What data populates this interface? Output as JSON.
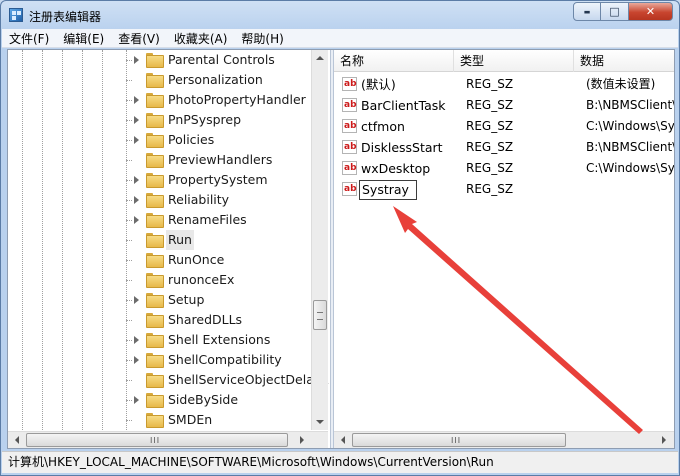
{
  "window": {
    "title": "注册表编辑器",
    "minimize_glyph": "▬",
    "maximize_glyph": "□",
    "close_glyph": "✕"
  },
  "menu": [
    "文件(F)",
    "编辑(E)",
    "查看(V)",
    "收藏夹(A)",
    "帮助(H)"
  ],
  "tree": {
    "items": [
      {
        "label": "Parental Controls",
        "expandable": true
      },
      {
        "label": "Personalization",
        "expandable": false
      },
      {
        "label": "PhotoPropertyHandler",
        "expandable": true
      },
      {
        "label": "PnPSysprep",
        "expandable": true
      },
      {
        "label": "Policies",
        "expandable": true
      },
      {
        "label": "PreviewHandlers",
        "expandable": false
      },
      {
        "label": "PropertySystem",
        "expandable": true
      },
      {
        "label": "Reliability",
        "expandable": true
      },
      {
        "label": "RenameFiles",
        "expandable": true
      },
      {
        "label": "Run",
        "expandable": false,
        "selected": true
      },
      {
        "label": "RunOnce",
        "expandable": false
      },
      {
        "label": "runonceEx",
        "expandable": false
      },
      {
        "label": "Setup",
        "expandable": true
      },
      {
        "label": "SharedDLLs",
        "expandable": false
      },
      {
        "label": "Shell Extensions",
        "expandable": true
      },
      {
        "label": "ShellCompatibility",
        "expandable": true
      },
      {
        "label": "ShellServiceObjectDelayL",
        "expandable": false
      },
      {
        "label": "SideBySide",
        "expandable": true
      },
      {
        "label": "SMDEn",
        "expandable": false
      }
    ],
    "hscroll_grip": "III"
  },
  "list": {
    "headers": {
      "name": "名称",
      "type": "类型",
      "data": "数据"
    },
    "value_icon": "ab",
    "rows": [
      {
        "name": "(默认)",
        "type": "REG_SZ",
        "data": "(数值未设置)"
      },
      {
        "name": "BarClientTask",
        "type": "REG_SZ",
        "data": "B:\\NBMSClient\\"
      },
      {
        "name": "ctfmon",
        "type": "REG_SZ",
        "data": "C:\\Windows\\Sys"
      },
      {
        "name": "DisklessStart",
        "type": "REG_SZ",
        "data": "B:\\NBMSClient\\"
      },
      {
        "name": "wxDesktop",
        "type": "REG_SZ",
        "data": "C:\\Windows\\Sys"
      },
      {
        "name": "Systray",
        "type": "REG_SZ",
        "data": "",
        "editing": true
      }
    ],
    "hscroll_grip": "III"
  },
  "status": {
    "path": "计算机\\HKEY_LOCAL_MACHINE\\SOFTWARE\\Microsoft\\Windows\\CurrentVersion\\Run"
  },
  "colors": {
    "arrow": "#e8403a",
    "title_bar": "#b9d1ee",
    "close_button": "#c8452f",
    "selection": "#e8e8e8"
  },
  "icons": {
    "app": "registry-editor-icon",
    "folder": "folder-icon",
    "value": "string-value-icon",
    "expander": "expand-arrow-icon"
  }
}
